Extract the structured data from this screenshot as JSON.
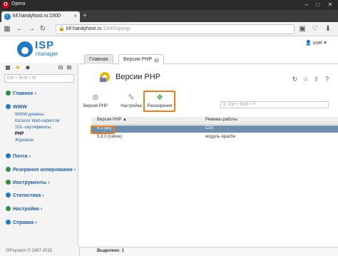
{
  "browser": {
    "name": "Opera",
    "tab_title": "kif.handyhost.ru:1500",
    "url_host": "kif.handyhost.ru",
    "url_rest": ":1500/ispmgr"
  },
  "header": {
    "logo_top": "ISP",
    "logo_bottom": "manager",
    "user": "user"
  },
  "content_tabs": [
    {
      "label": "Главная"
    },
    {
      "label": "Версии PHP"
    }
  ],
  "sidebar": {
    "search_placeholder": "Ctrl + Shift + M",
    "sections": [
      {
        "label": "Главное",
        "color": "#2f8f3f"
      },
      {
        "label": "WWW",
        "color": "#1f79c4"
      },
      {
        "label": "Почта",
        "color": "#1f79c4"
      },
      {
        "label": "Резервное копирование",
        "color": "#2f8f3f"
      },
      {
        "label": "Инструменты",
        "color": "#2f8f3f"
      },
      {
        "label": "Статистика",
        "color": "#1f79c4"
      },
      {
        "label": "Настройки",
        "color": "#2f8f3f"
      },
      {
        "label": "Справка",
        "color": "#1f79c4"
      }
    ],
    "www_items": [
      "WWW-домены",
      "Каталог Web-скриптов",
      "SSL-сертификаты",
      "PHP",
      "Журналы"
    ],
    "footer": "ISPsystem © 1997-2015"
  },
  "main": {
    "title": "Версии PHP",
    "toolbar": [
      {
        "label": "Версия PHP",
        "icon": "php-icon"
      },
      {
        "label": "Настройка",
        "icon": "settings-icon"
      },
      {
        "label": "Расширения",
        "icon": "extensions-icon"
      }
    ],
    "search_placeholder": "Ctrl + Shift + F",
    "table": {
      "columns": [
        "Версия PHP",
        "Режимы работы"
      ],
      "rows": [
        {
          "version": "5.3 (alt)",
          "mode": "CGI"
        },
        {
          "version": "5.3.3 (native)",
          "mode": "модуль Apache"
        }
      ]
    },
    "status": "Выделено: 1"
  },
  "colors": {
    "accent": "#1f79c4",
    "highlight": "#f07b1a",
    "selected_row": "#6f8fae"
  }
}
